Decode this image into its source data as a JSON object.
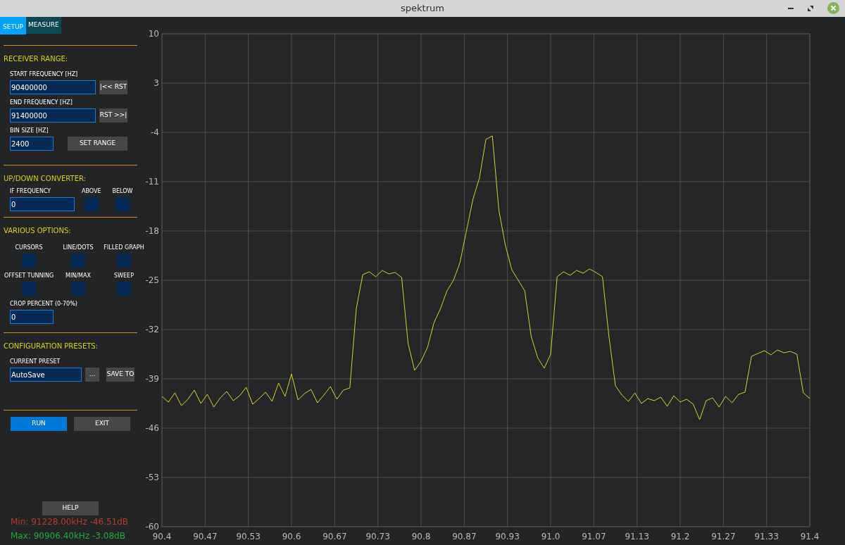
{
  "window": {
    "title": "spektrum"
  },
  "tabs": [
    {
      "label": "SETUP",
      "selected": true
    },
    {
      "label": "MEASURE",
      "selected": false
    }
  ],
  "receiver_range": {
    "heading": "RECEIVER RANGE:",
    "start_label": "START FREQUENCY [HZ]",
    "start_value": "90400000",
    "start_button": "|<< RST",
    "end_label": "END FREQUENCY [HZ]",
    "end_value": "91400000",
    "end_button": "RST >>|",
    "bin_label": "BIN SIZE [HZ]",
    "bin_value": "2400",
    "set_button": "SET RANGE"
  },
  "converter": {
    "heading": "UP/DOWN CONVERTER:",
    "if_label": "IF FREQUENCY",
    "if_value": "0",
    "above": {
      "label": "ABOVE",
      "checked": false
    },
    "below": {
      "label": "BELOW",
      "checked": false
    }
  },
  "options": {
    "heading": "VARIOUS OPTIONS:",
    "checkboxes": [
      {
        "label": "CURSORS",
        "checked": false
      },
      {
        "label": "LINE/DOTS",
        "checked": false
      },
      {
        "label": "FILLED GRAPH",
        "checked": false
      },
      {
        "label": "OFFSET TUNNING",
        "checked": false
      },
      {
        "label": "MIN/MAX",
        "checked": false
      },
      {
        "label": "SWEEP",
        "checked": false
      }
    ],
    "crop_label": "CROP PERCENT (0-70%)",
    "crop_value": "0"
  },
  "presets": {
    "heading": "CONFIGURATION PRESETS:",
    "current_label": "CURRENT PRESET",
    "current_value": "AutoSave",
    "browse_button": "...",
    "save_button": "SAVE TO"
  },
  "run_button": "RUN",
  "exit_button": "EXIT",
  "help_button": "HELP",
  "min_reading": "Min: 91228.00kHz -46.51dB",
  "max_reading": "Max: 90906.40kHz -3.08dB",
  "spectrum": {
    "chart_data": {
      "type": "line",
      "grid": true,
      "xlim": [
        90.4,
        91.4
      ],
      "ylim": [
        -60,
        10
      ],
      "yticks": [
        10,
        3,
        -4,
        -11,
        -18,
        -25,
        -32,
        -39,
        -46,
        -53,
        -60
      ],
      "xticks": [
        {
          "value": 90.4,
          "label": "90.4"
        },
        {
          "value": 90.4667,
          "label": "90.47"
        },
        {
          "value": 90.5333,
          "label": "90.53"
        },
        {
          "value": 90.6,
          "label": "90.6"
        },
        {
          "value": 90.6667,
          "label": "90.67"
        },
        {
          "value": 90.7333,
          "label": "90.73"
        },
        {
          "value": 90.8,
          "label": "90.8"
        },
        {
          "value": 90.8667,
          "label": "90.87"
        },
        {
          "value": 90.9333,
          "label": "90.93"
        },
        {
          "value": 91.0,
          "label": "91.0"
        },
        {
          "value": 91.0667,
          "label": "91.07"
        },
        {
          "value": 91.1333,
          "label": "91.13"
        },
        {
          "value": 91.2,
          "label": "91.2"
        },
        {
          "value": 91.2667,
          "label": "91.27"
        },
        {
          "value": 91.3333,
          "label": "91.33"
        },
        {
          "value": 91.4,
          "label": "91.4"
        }
      ],
      "x": [
        90.4,
        90.41,
        90.42,
        90.43,
        90.44,
        90.45,
        90.46,
        90.47,
        90.48,
        90.49,
        90.5,
        90.51,
        90.52,
        90.53,
        90.54,
        90.55,
        90.56,
        90.57,
        90.58,
        90.59,
        90.6,
        90.61,
        90.62,
        90.63,
        90.64,
        90.65,
        90.66,
        90.67,
        90.68,
        90.69,
        90.7,
        90.71,
        90.72,
        90.73,
        90.74,
        90.75,
        90.76,
        90.77,
        90.78,
        90.79,
        90.8,
        90.81,
        90.82,
        90.83,
        90.84,
        90.85,
        90.86,
        90.87,
        90.88,
        90.89,
        90.9,
        90.91,
        90.92,
        90.93,
        90.94,
        90.95,
        90.96,
        90.97,
        90.98,
        90.99,
        91.0,
        91.01,
        91.02,
        91.03,
        91.04,
        91.05,
        91.06,
        91.07,
        91.08,
        91.09,
        91.1,
        91.11,
        91.12,
        91.13,
        91.14,
        91.15,
        91.16,
        91.17,
        91.18,
        91.19,
        91.2,
        91.21,
        91.22,
        91.23,
        91.24,
        91.25,
        91.26,
        91.27,
        91.28,
        91.29,
        91.3,
        91.31,
        91.32,
        91.33,
        91.34,
        91.35,
        91.36,
        91.37,
        91.38,
        91.39,
        91.4
      ],
      "series": [
        {
          "color": "#d2d22c",
          "values": [
            -41.5,
            -42.3,
            -41,
            -42.8,
            -41.9,
            -40.6,
            -42.5,
            -41.2,
            -43,
            -41.7,
            -40.8,
            -42.1,
            -41.4,
            -40.2,
            -42.6,
            -41.8,
            -40.9,
            -42.2,
            -39.6,
            -41.5,
            -38.3,
            -42,
            -41.1,
            -40.5,
            -42.4,
            -41.3,
            -40.1,
            -41.9,
            -40.6,
            -40.3,
            -29,
            -24.2,
            -23.8,
            -24.5,
            -23.6,
            -24.1,
            -23.9,
            -24.6,
            -34,
            -37.8,
            -36.5,
            -34.5,
            -31,
            -29,
            -26.5,
            -25,
            -22.5,
            -18,
            -13.5,
            -10.5,
            -5,
            -4.5,
            -15,
            -20,
            -23.5,
            -25,
            -26.5,
            -33,
            -36,
            -37.5,
            -35.5,
            -24.5,
            -23.8,
            -24.3,
            -23.6,
            -24,
            -23.4,
            -23.9,
            -24.5,
            -33,
            -40,
            -41.3,
            -42.2,
            -41,
            -42.5,
            -41.8,
            -42.1,
            -41.6,
            -42.9,
            -41.4,
            -42.3,
            -41.9,
            -42.6,
            -44.8,
            -42.1,
            -41.7,
            -43,
            -41.5,
            -42.4,
            -41.2,
            -40.9,
            -35.8,
            -35.4,
            -35,
            -35.6,
            -34.9,
            -35.3,
            -35.1,
            -35.5,
            -41,
            -41.8
          ]
        }
      ]
    }
  }
}
